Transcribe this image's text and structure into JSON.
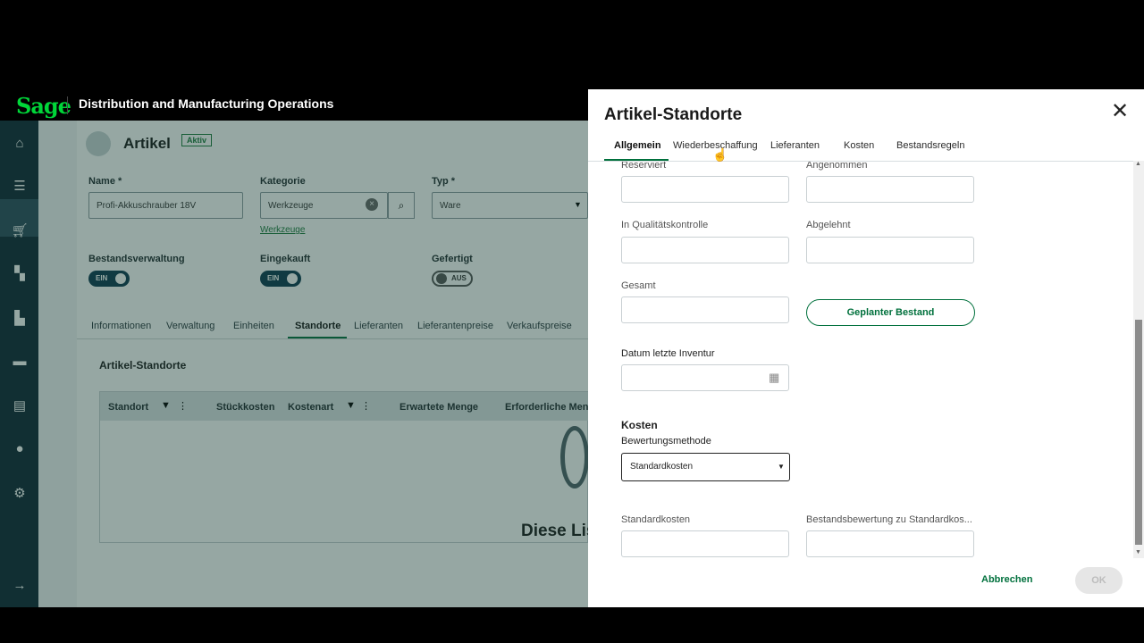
{
  "app": {
    "logo": "Sage",
    "title": "Distribution and Manufacturing Operations"
  },
  "sidebar": {
    "icons": [
      "home-icon",
      "list-icon",
      "cart-icon",
      "structure-icon",
      "factory-icon",
      "card-icon",
      "book-icon",
      "people-icon",
      "gear-icon",
      "expand-arrow-icon"
    ]
  },
  "page": {
    "title": "Artikel",
    "status": "Aktiv",
    "fields": {
      "name_label": "Name *",
      "name_value": "Profi-Akkuschrauber 18V",
      "category_label": "Kategorie",
      "category_value": "Werkzeuge",
      "category_link": "Werkzeuge",
      "type_label": "Typ *",
      "type_value": "Ware"
    },
    "toggles": {
      "stock_label": "Bestandsverwaltung",
      "stock_value": "EIN",
      "purchased_label": "Eingekauft",
      "purchased_value": "EIN",
      "manufactured_label": "Gefertigt",
      "manufactured_value": "AUS"
    },
    "tabs": [
      "Informationen",
      "Verwaltung",
      "Einheiten",
      "Standorte",
      "Lieferanten",
      "Lieferantenpreise",
      "Verkaufspreise"
    ],
    "section_title": "Artikel-Standorte",
    "table_headers": [
      "Standort",
      "Stückkosten",
      "Kostenart",
      "Erwartete Menge",
      "Erforderliche Meng"
    ],
    "empty_text": "Diese Lis"
  },
  "panel": {
    "title": "Artikel-Standorte",
    "tabs": [
      "Allgemein",
      "Wiederbeschaffung",
      "Lieferanten",
      "Kosten",
      "Bestandsregeln"
    ],
    "fields": {
      "reserved": "Reserviert",
      "accepted": "Angenommen",
      "qc": "In Qualitätskontrolle",
      "rejected": "Abgelehnt",
      "total": "Gesamt",
      "planned_button": "Geplanter Bestand",
      "last_inventory": "Datum letzte Inventur"
    },
    "costs": {
      "section": "Kosten",
      "valuation_label": "Bewertungsmethode",
      "valuation_value": "Standardkosten",
      "std_cost_label": "Standardkosten",
      "stock_valuation_label": "Bestandsbewertung zu Standardkos..."
    },
    "footer": {
      "cancel": "Abbrechen",
      "ok": "OK"
    }
  }
}
